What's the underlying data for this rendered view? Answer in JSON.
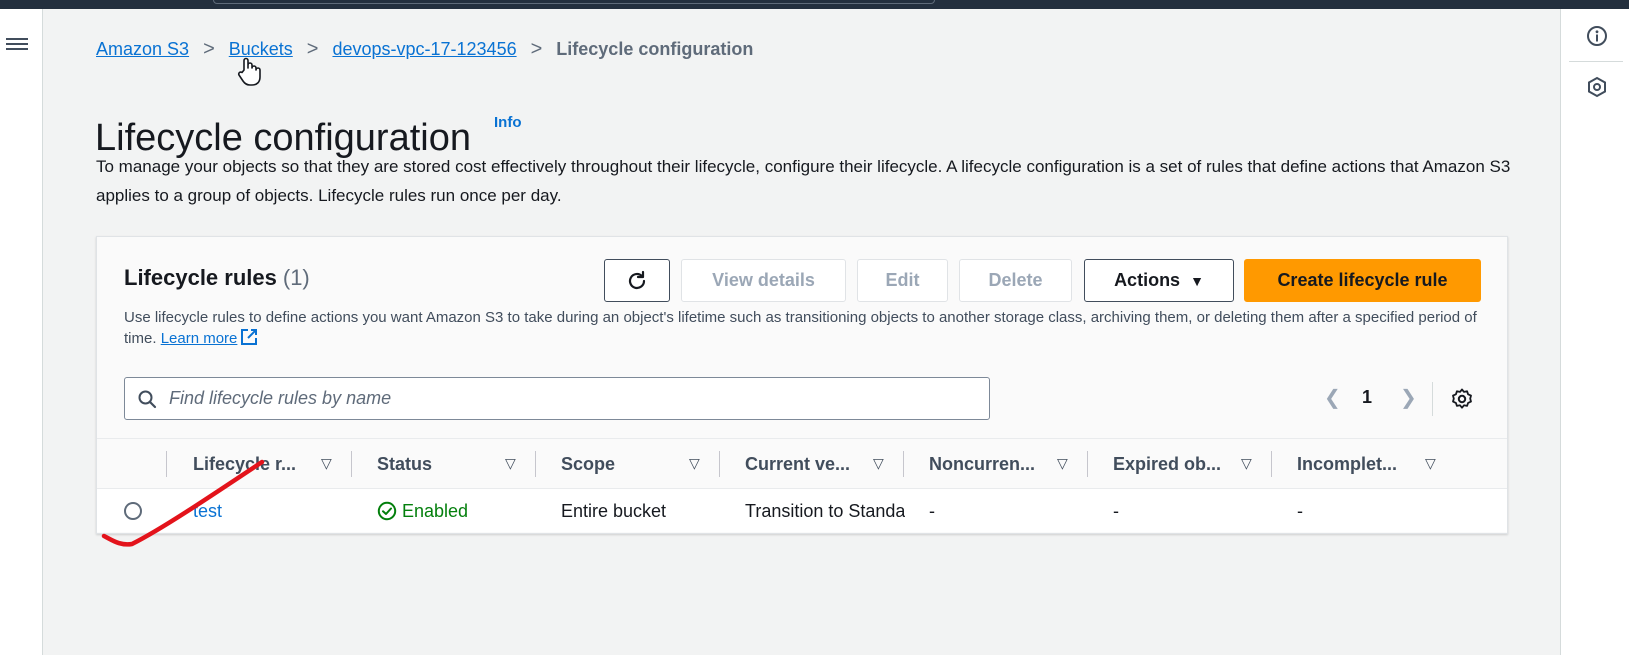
{
  "colors": {
    "topbar": "#232f3e",
    "link": "#0972d3",
    "primary_button": "#ff9900",
    "success": "#037f0c",
    "annotation_stroke": "#e3131b"
  },
  "nav": {
    "menu_icon": "hamburger-icon",
    "right_rail_icons": [
      "info-circle-icon",
      "hexagon-help-icon"
    ]
  },
  "breadcrumb": {
    "items": [
      "Amazon S3",
      "Buckets",
      "devops-vpc-17-123456"
    ],
    "current": "Lifecycle configuration",
    "separator": ">"
  },
  "page": {
    "title": "Lifecycle configuration",
    "info_label": "Info",
    "description": "To manage your objects so that they are stored cost effectively throughout their lifecycle, configure their lifecycle. A lifecycle configuration is a set of rules that define actions that Amazon S3 applies to a group of objects. Lifecycle rules run once per day."
  },
  "rules_panel": {
    "title": "Lifecycle rules",
    "count": "(1)",
    "description": "Use lifecycle rules to define actions you want Amazon S3 to take during an object's lifetime such as transitioning objects to another storage class, archiving them, or deleting them after a specified period of time.",
    "learn_more": "Learn more",
    "buttons": {
      "refresh_icon": "refresh-icon",
      "view_details": "View details",
      "edit": "Edit",
      "delete": "Delete",
      "actions": "Actions",
      "create": "Create lifecycle rule"
    },
    "search": {
      "placeholder": "Find lifecycle rules by name",
      "value": ""
    },
    "pagination": {
      "current_page": "1"
    },
    "columns": [
      "Lifecycle r...",
      "Status",
      "Scope",
      "Current ve...",
      "Noncurren...",
      "Expired ob...",
      "Incomplet..."
    ],
    "rows": [
      {
        "name": "test",
        "status": "Enabled",
        "scope": "Entire bucket",
        "current_version": "Transition to Standa",
        "noncurrent": "-",
        "expired": "-",
        "incomplete": "-"
      }
    ]
  }
}
